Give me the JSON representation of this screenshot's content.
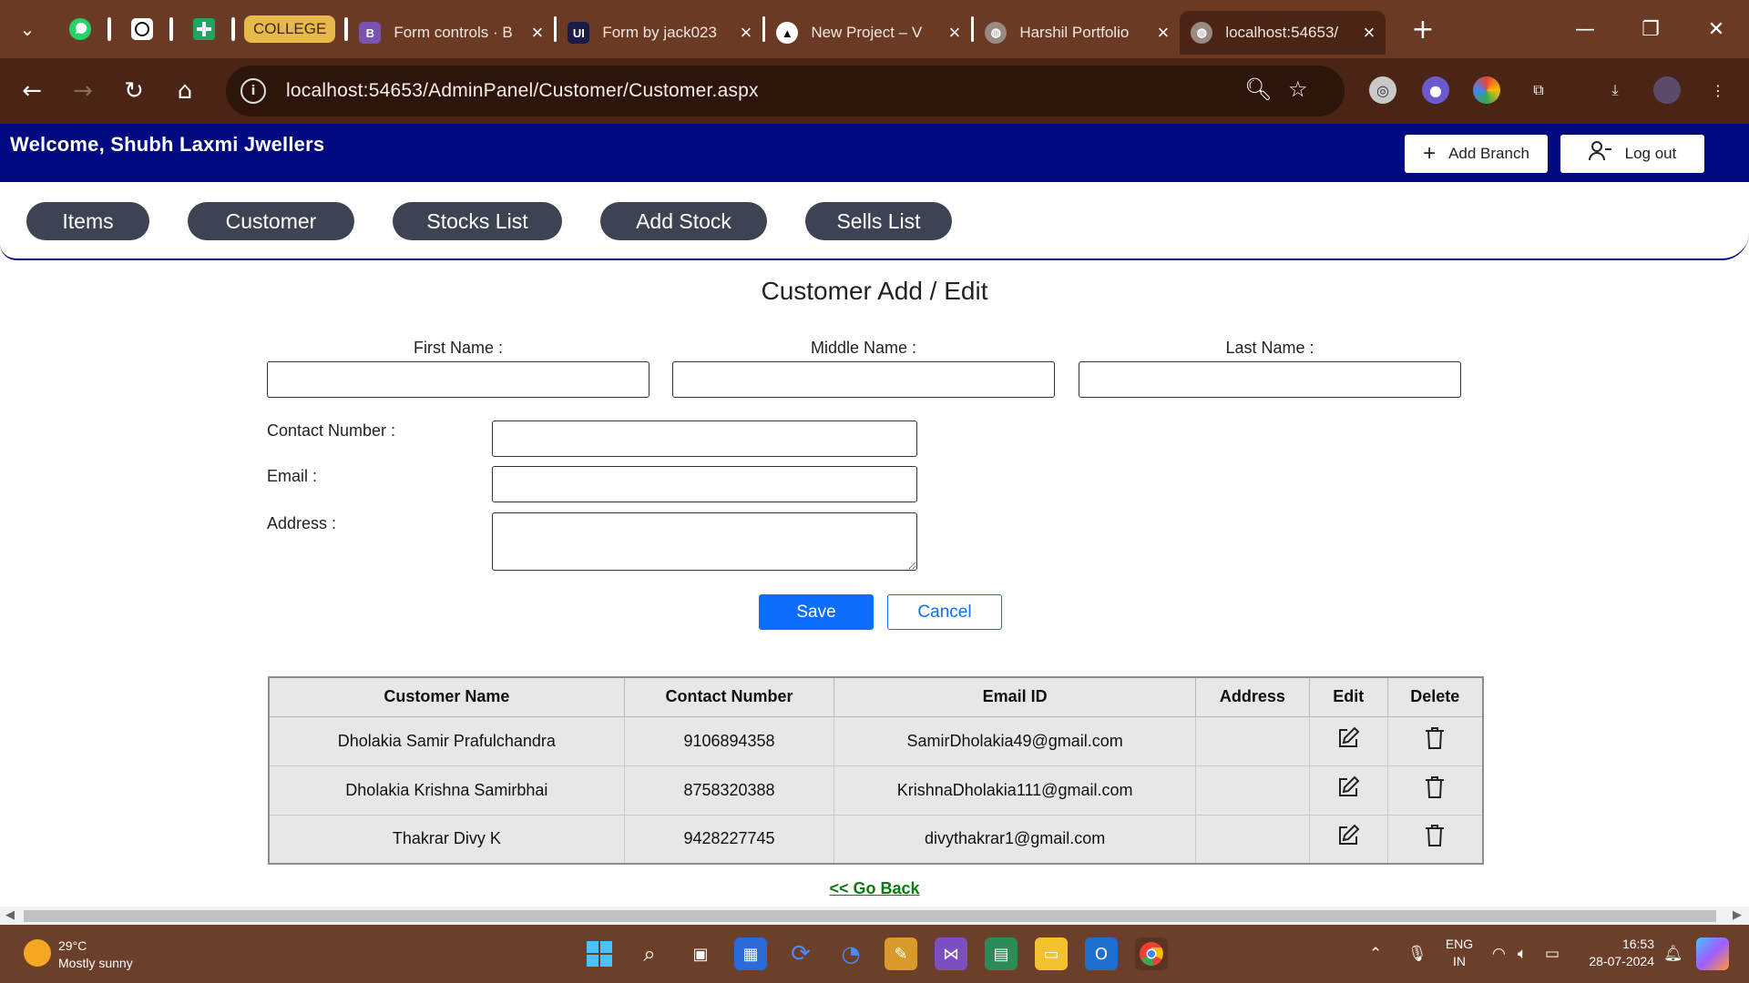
{
  "browser": {
    "tabs": [
      {
        "label": "COLLEGE"
      },
      {
        "label": "Form controls · B"
      },
      {
        "label": "Form by jack023"
      },
      {
        "label": "New Project – V"
      },
      {
        "label": "Harshil Portfolio"
      },
      {
        "label": "localhost:54653/"
      }
    ],
    "url": "localhost:54653/AdminPanel/Customer/Customer.aspx"
  },
  "header": {
    "welcome": "Welcome, Shubh Laxmi Jwellers",
    "add_branch": "Add Branch",
    "logout": "Log out"
  },
  "nav": {
    "items": [
      {
        "label": "Items"
      },
      {
        "label": "Customer"
      },
      {
        "label": "Stocks List"
      },
      {
        "label": "Add Stock"
      },
      {
        "label": "Sells List"
      }
    ]
  },
  "form": {
    "title": "Customer Add / Edit",
    "first_name_label": "First Name :",
    "middle_name_label": "Middle Name :",
    "last_name_label": "Last Name :",
    "contact_label": "Contact Number :",
    "email_label": "Email :",
    "address_label": "Address :",
    "first_name": "",
    "middle_name": "",
    "last_name": "",
    "contact": "",
    "email": "",
    "address": "",
    "save": "Save",
    "cancel": "Cancel"
  },
  "table": {
    "headers": [
      "Customer Name",
      "Contact Number",
      "Email ID",
      "Address",
      "Edit",
      "Delete"
    ],
    "rows": [
      {
        "name": "Dholakia Samir Prafulchandra",
        "contact": "9106894358",
        "email": "SamirDholakia49@gmail.com",
        "address": ""
      },
      {
        "name": "Dholakia Krishna Samirbhai",
        "contact": "8758320388",
        "email": "KrishnaDholakia111@gmail.com",
        "address": ""
      },
      {
        "name": "Thakrar Divy K",
        "contact": "9428227745",
        "email": "divythakrar1@gmail.com",
        "address": ""
      }
    ]
  },
  "go_back": "<< Go Back",
  "taskbar": {
    "temperature": "29°C",
    "weather": "Mostly sunny",
    "lang": "ENG",
    "region": "IN",
    "time": "16:53",
    "date": "28-07-2024"
  }
}
